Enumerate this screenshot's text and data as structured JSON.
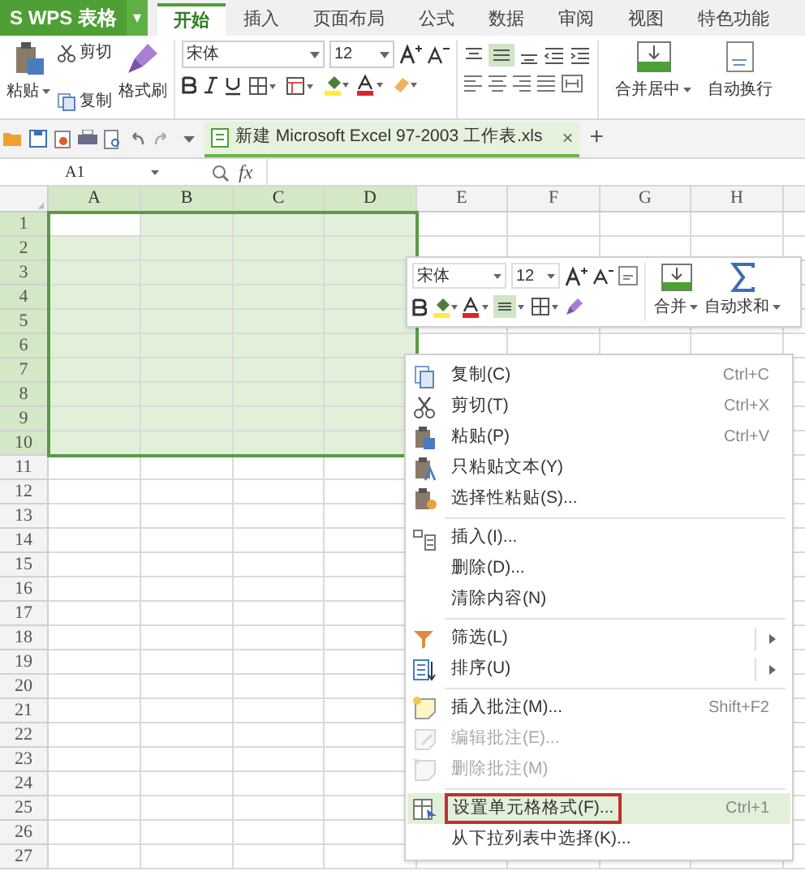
{
  "app_button": {
    "label": "S WPS 表格",
    "caret": "▾"
  },
  "tabs": [
    {
      "label": "开始",
      "selected": true
    },
    {
      "label": "插入",
      "selected": false
    },
    {
      "label": "页面布局",
      "selected": false
    },
    {
      "label": "公式",
      "selected": false
    },
    {
      "label": "数据",
      "selected": false
    },
    {
      "label": "审阅",
      "selected": false
    },
    {
      "label": "视图",
      "selected": false
    },
    {
      "label": "特色功能",
      "selected": false
    }
  ],
  "ribbon": {
    "paste": "粘贴",
    "cut": "剪切",
    "copy": "复制",
    "format_painter": "格式刷",
    "font_name": "宋体",
    "font_size": "12",
    "merge": "合并居中",
    "wrap": "自动换行"
  },
  "document_tab": {
    "title": "新建 Microsoft Excel 97-2003 工作表.xls",
    "close": "×",
    "new_tab": "+"
  },
  "formula_bar": {
    "cell": "A1",
    "fx": "fx"
  },
  "sheet": {
    "columns": [
      {
        "label": "A",
        "selected": true
      },
      {
        "label": "B",
        "selected": true
      },
      {
        "label": "C",
        "selected": true
      },
      {
        "label": "D",
        "selected": true
      },
      {
        "label": "E",
        "selected": false
      },
      {
        "label": "F",
        "selected": false
      },
      {
        "label": "G",
        "selected": false
      },
      {
        "label": "H",
        "selected": false
      }
    ],
    "rows": [
      {
        "label": "1",
        "selected": true
      },
      {
        "label": "2",
        "selected": true
      },
      {
        "label": "3",
        "selected": true
      },
      {
        "label": "4",
        "selected": true
      },
      {
        "label": "5",
        "selected": true
      },
      {
        "label": "6",
        "selected": true
      },
      {
        "label": "7",
        "selected": true
      },
      {
        "label": "8",
        "selected": true
      },
      {
        "label": "9",
        "selected": true
      },
      {
        "label": "10",
        "selected": true
      },
      {
        "label": "11",
        "selected": false
      },
      {
        "label": "12",
        "selected": false
      },
      {
        "label": "13",
        "selected": false
      },
      {
        "label": "14",
        "selected": false
      },
      {
        "label": "15",
        "selected": false
      },
      {
        "label": "16",
        "selected": false
      },
      {
        "label": "17",
        "selected": false
      },
      {
        "label": "18",
        "selected": false
      },
      {
        "label": "19",
        "selected": false
      },
      {
        "label": "20",
        "selected": false
      },
      {
        "label": "21",
        "selected": false
      },
      {
        "label": "22",
        "selected": false
      },
      {
        "label": "23",
        "selected": false
      },
      {
        "label": "24",
        "selected": false
      },
      {
        "label": "25",
        "selected": false
      },
      {
        "label": "26",
        "selected": false
      },
      {
        "label": "27",
        "selected": false
      }
    ]
  },
  "mini_toolbar": {
    "font_name": "宋体",
    "font_size": "12",
    "merge": "合并",
    "autosum": "自动求和"
  },
  "context_menu": [
    {
      "kind": "item",
      "label": "复制(C)",
      "shortcut": "Ctrl+C",
      "disabled": false,
      "selected": false
    },
    {
      "kind": "item",
      "label": "剪切(T)",
      "shortcut": "Ctrl+X",
      "disabled": false,
      "selected": false
    },
    {
      "kind": "item",
      "label": "粘贴(P)",
      "shortcut": "Ctrl+V",
      "disabled": false,
      "selected": false
    },
    {
      "kind": "item",
      "label": "只粘贴文本(Y)",
      "disabled": false,
      "selected": false
    },
    {
      "kind": "item",
      "label": "选择性粘贴(S)...",
      "disabled": false,
      "selected": false
    },
    {
      "kind": "separator"
    },
    {
      "kind": "item",
      "label": "插入(I)...",
      "disabled": false,
      "selected": false
    },
    {
      "kind": "item",
      "label": "删除(D)...",
      "disabled": false,
      "selected": false
    },
    {
      "kind": "item",
      "label": "清除内容(N)",
      "disabled": false,
      "selected": false
    },
    {
      "kind": "separator"
    },
    {
      "kind": "item",
      "label": "筛选(L)",
      "submenu": true,
      "disabled": false,
      "selected": false
    },
    {
      "kind": "item",
      "label": "排序(U)",
      "submenu": true,
      "disabled": false,
      "selected": false
    },
    {
      "kind": "separator"
    },
    {
      "kind": "item",
      "label": "插入批注(M)...",
      "shortcut": "Shift+F2",
      "disabled": false,
      "selected": false
    },
    {
      "kind": "item",
      "label": "编辑批注(E)...",
      "disabled": true,
      "selected": false
    },
    {
      "kind": "item",
      "label": "删除批注(M)",
      "disabled": true,
      "selected": false
    },
    {
      "kind": "separator"
    },
    {
      "kind": "item",
      "label": "设置单元格格式(F)...",
      "shortcut": "Ctrl+1",
      "disabled": false,
      "selected": true
    },
    {
      "kind": "item",
      "label": "从下拉列表中选择(K)...",
      "disabled": false,
      "selected": false
    }
  ]
}
